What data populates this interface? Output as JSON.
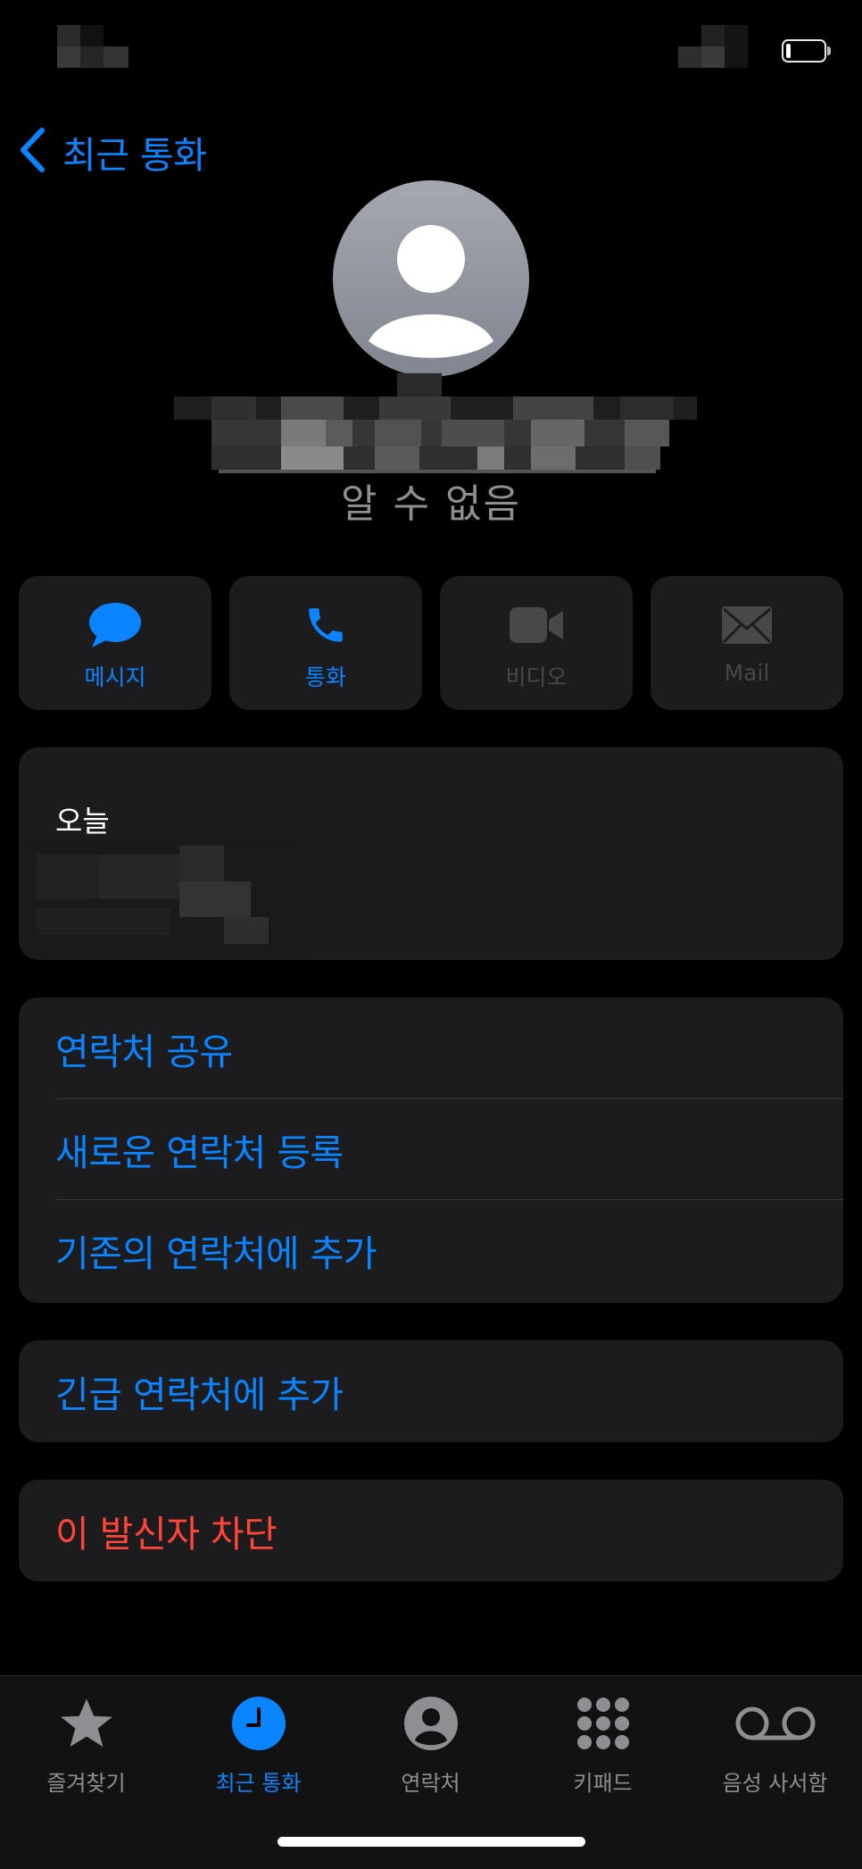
{
  "nav": {
    "back_label": "최근 통화"
  },
  "contact": {
    "status_text": "알 수 없음"
  },
  "actions": [
    {
      "label": "메시지",
      "icon": "message-bubble-icon",
      "enabled": true
    },
    {
      "label": "통화",
      "icon": "phone-icon",
      "enabled": true
    },
    {
      "label": "비디오",
      "icon": "video-icon",
      "enabled": false
    },
    {
      "label": "Mail",
      "icon": "mail-icon",
      "enabled": false
    }
  ],
  "call_log": {
    "date_label": "오늘"
  },
  "contact_options": [
    "연락처 공유",
    "새로운 연락처 등록",
    "기존의 연락처에 추가"
  ],
  "emergency": {
    "label": "긴급 연락처에 추가"
  },
  "block": {
    "label": "이 발신자 차단"
  },
  "tabs": [
    {
      "label": "즐겨찾기",
      "icon": "star-icon",
      "active": false
    },
    {
      "label": "최근 통화",
      "icon": "clock-icon",
      "active": true
    },
    {
      "label": "연락처",
      "icon": "contact-person-icon",
      "active": false
    },
    {
      "label": "키패드",
      "icon": "keypad-icon",
      "active": false
    },
    {
      "label": "음성 사서함",
      "icon": "voicemail-icon",
      "active": false
    }
  ],
  "colors": {
    "accent": "#0a84ff",
    "destructive": "#ff453a",
    "card": "#1c1c1e",
    "secondary_text": "#8e8e93"
  }
}
